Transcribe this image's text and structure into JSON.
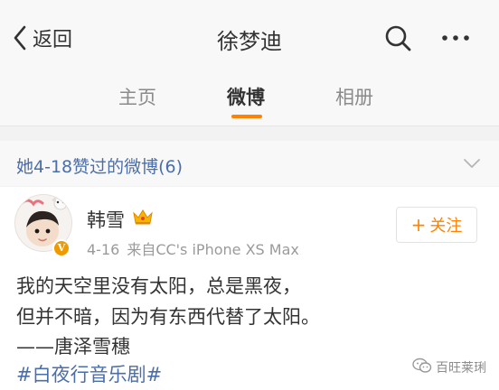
{
  "navbar": {
    "back_label": "返回",
    "title": "徐梦迪",
    "search_icon": "search-icon",
    "more_icon": "more-icon"
  },
  "tabs": [
    {
      "label": "主页",
      "active": false
    },
    {
      "label": "微博",
      "active": true
    },
    {
      "label": "相册",
      "active": false
    }
  ],
  "section": {
    "title": "她4-18赞过的微博(6)",
    "chevron_icon": "chevron-down-icon"
  },
  "post": {
    "author": "韩雪",
    "author_badge_icon": "crown-icon",
    "date": "4-16",
    "source": "来自CC's iPhone XS Max",
    "follow_label": "关注",
    "lines": [
      "我的天空里没有太阳，总是黑夜，",
      "但并不暗，因为有东西代替了太阳。",
      "——唐泽雪穗"
    ],
    "hashtag": "#白夜行音乐剧#"
  },
  "watermark": {
    "text": "百旺莱琍"
  },
  "colors": {
    "accent": "#ff8200",
    "link": "#4a6ea9",
    "text": "#333333",
    "muted": "#9a9a9a"
  }
}
